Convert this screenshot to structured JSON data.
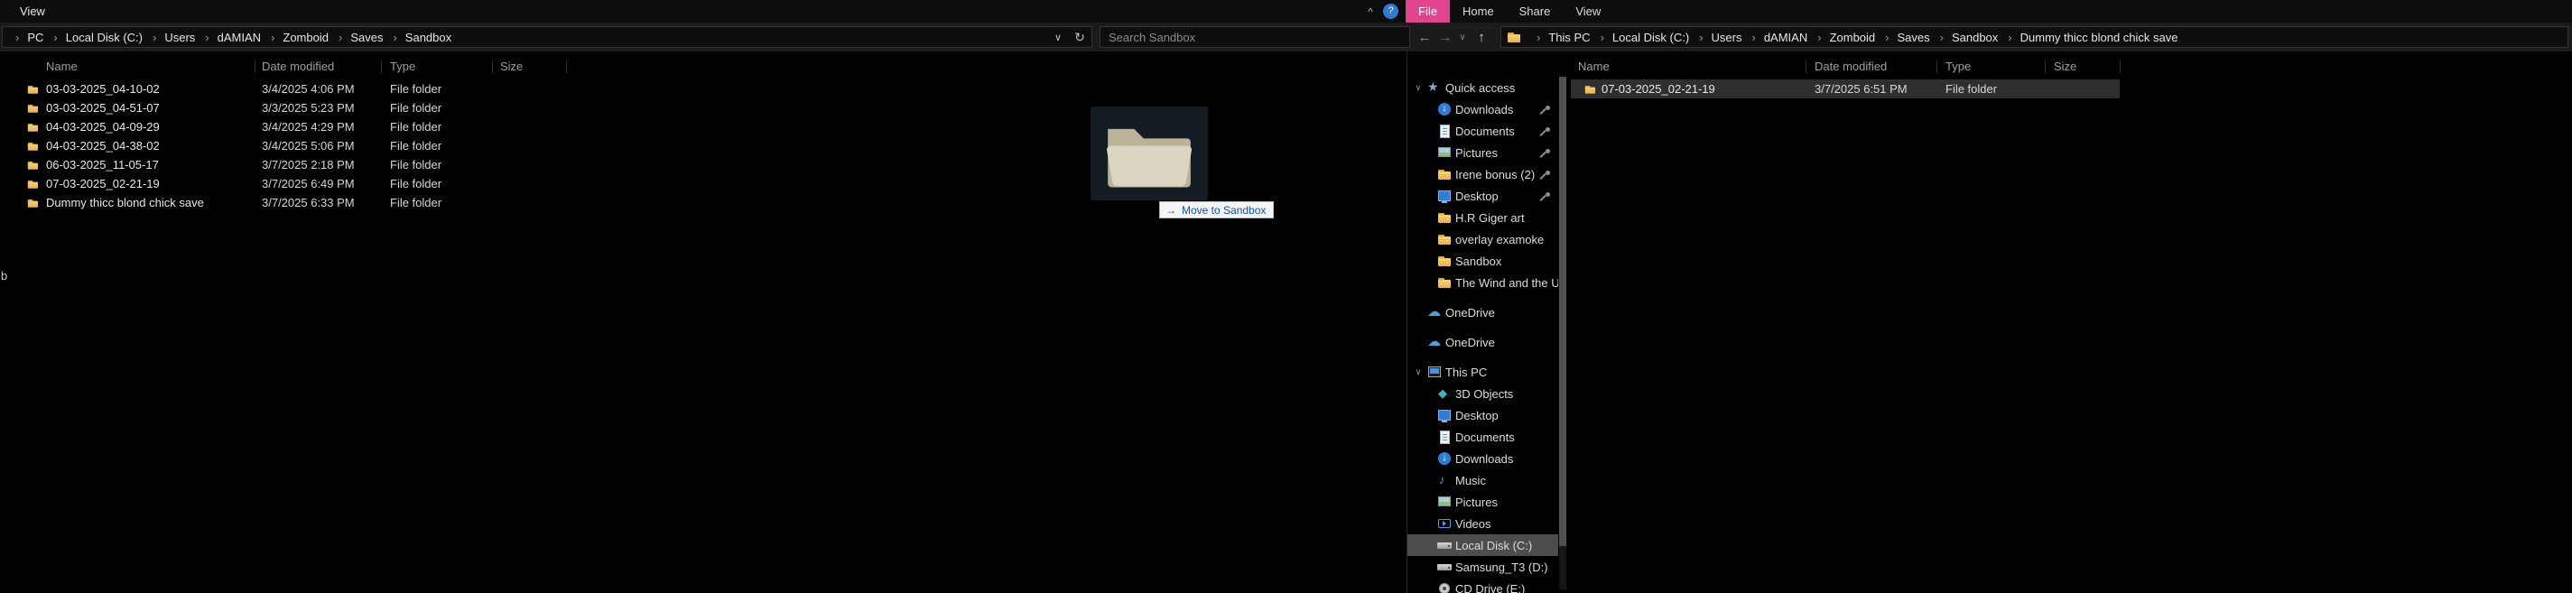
{
  "colors": {
    "accent_pink": "#e2438f",
    "folder_yellow": "#f0c050",
    "sidebar_selection": "#4d4d4d",
    "row_highlight": "#2f2f2f",
    "tooltip_blue": "#0a53be"
  },
  "top_bar": {
    "background_window_menu_tab": "View",
    "ribbon_collapse_icon": "^",
    "help_icon": "?",
    "tabs": [
      {
        "label": "File",
        "active": true
      },
      {
        "label": "Home"
      },
      {
        "label": "Share"
      },
      {
        "label": "View"
      }
    ]
  },
  "left_window": {
    "breadcrumb": [
      "PC",
      "Local Disk (C:)",
      "Users",
      "dAMIAN",
      "Zomboid",
      "Saves",
      "Sandbox"
    ],
    "address_dropdown_icon": "∨",
    "refresh_icon": "↻",
    "search_placeholder": "Search Sandbox",
    "columns": [
      "Name",
      "Date modified",
      "Type",
      "Size"
    ],
    "rows": [
      {
        "name": "03-03-2025_04-10-02",
        "date_modified": "3/4/2025 4:06 PM",
        "type": "File folder",
        "size": ""
      },
      {
        "name": "03-03-2025_04-51-07",
        "date_modified": "3/3/2025 5:23 PM",
        "type": "File folder",
        "size": ""
      },
      {
        "name": "04-03-2025_04-09-29",
        "date_modified": "3/4/2025 4:29 PM",
        "type": "File folder",
        "size": ""
      },
      {
        "name": "04-03-2025_04-38-02",
        "date_modified": "3/4/2025 5:06 PM",
        "type": "File folder",
        "size": ""
      },
      {
        "name": "06-03-2025_11-05-17",
        "date_modified": "3/7/2025 2:18 PM",
        "type": "File folder",
        "size": ""
      },
      {
        "name": "07-03-2025_02-21-19",
        "date_modified": "3/7/2025 6:49 PM",
        "type": "File folder",
        "size": ""
      },
      {
        "name": "Dummy thicc blond chick save",
        "date_modified": "3/7/2025 6:33 PM",
        "type": "File folder",
        "size": ""
      }
    ]
  },
  "drag_operation": {
    "tooltip_arrow": "→",
    "tooltip_label": "Move to Sandbox"
  },
  "right_window": {
    "nav": {
      "back_icon": "←",
      "forward_icon": "→",
      "history_dropdown_icon": "∨",
      "up_icon": "↑"
    },
    "breadcrumb": [
      "This PC",
      "Local Disk (C:)",
      "Users",
      "dAMIAN",
      "Zomboid",
      "Saves",
      "Sandbox",
      "Dummy thicc blond chick save"
    ],
    "sidebar": [
      {
        "label": "Quick access",
        "icon": "star",
        "expander": true
      },
      {
        "label": "Downloads",
        "icon": "download",
        "child": true,
        "pinned": true
      },
      {
        "label": "Documents",
        "icon": "document",
        "child": true,
        "pinned": true
      },
      {
        "label": "Pictures",
        "icon": "picture",
        "child": true,
        "pinned": true
      },
      {
        "label": "Irene bonus (2)",
        "icon": "folder",
        "child": true,
        "pinned": true
      },
      {
        "label": "Desktop",
        "icon": "desktop",
        "child": true,
        "pinned": true
      },
      {
        "label": "H.R Giger art",
        "icon": "folder",
        "child": true
      },
      {
        "label": "overlay examoke",
        "icon": "folder",
        "child": true
      },
      {
        "label": "Sandbox",
        "icon": "folder",
        "child": true
      },
      {
        "label": "The Wind and the Umb",
        "icon": "folder",
        "child": true
      },
      {
        "label": "OneDrive",
        "icon": "cloud",
        "gap": true
      },
      {
        "label": "OneDrive",
        "icon": "cloud",
        "gap": true
      },
      {
        "label": "This PC",
        "icon": "pc",
        "expander": true,
        "gap": true
      },
      {
        "label": "3D Objects",
        "icon": "cube",
        "child": true
      },
      {
        "label": "Desktop",
        "icon": "desktop",
        "child": true
      },
      {
        "label": "Documents",
        "icon": "document",
        "child": true
      },
      {
        "label": "Downloads",
        "icon": "download",
        "child": true
      },
      {
        "label": "Music",
        "icon": "music",
        "child": true
      },
      {
        "label": "Pictures",
        "icon": "picture",
        "child": true
      },
      {
        "label": "Videos",
        "icon": "video",
        "child": true
      },
      {
        "label": "Local Disk (C:)",
        "icon": "drive",
        "child": true,
        "selected": true
      },
      {
        "label": "Samsung_T3 (D:)",
        "icon": "drive",
        "child": true
      },
      {
        "label": "CD Drive (E:)",
        "icon": "disc",
        "child": true
      }
    ],
    "columns": [
      "Name",
      "Date modified",
      "Type",
      "Size"
    ],
    "rows": [
      {
        "name": "07-03-2025_02-21-19",
        "date_modified": "3/7/2025 6:51 PM",
        "type": "File folder",
        "size": "",
        "selected": true
      }
    ]
  },
  "stray_text": "b"
}
